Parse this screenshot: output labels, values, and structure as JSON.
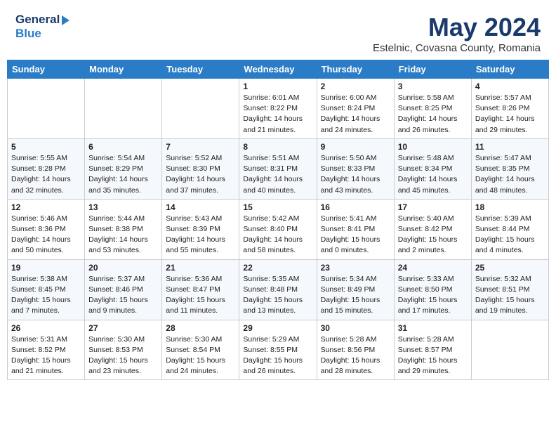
{
  "header": {
    "logo_line1": "General",
    "logo_line2": "Blue",
    "month": "May 2024",
    "location": "Estelnic, Covasna County, Romania"
  },
  "weekdays": [
    "Sunday",
    "Monday",
    "Tuesday",
    "Wednesday",
    "Thursday",
    "Friday",
    "Saturday"
  ],
  "weeks": [
    [
      {
        "day": "",
        "info": ""
      },
      {
        "day": "",
        "info": ""
      },
      {
        "day": "",
        "info": ""
      },
      {
        "day": "1",
        "info": "Sunrise: 6:01 AM\nSunset: 8:22 PM\nDaylight: 14 hours\nand 21 minutes."
      },
      {
        "day": "2",
        "info": "Sunrise: 6:00 AM\nSunset: 8:24 PM\nDaylight: 14 hours\nand 24 minutes."
      },
      {
        "day": "3",
        "info": "Sunrise: 5:58 AM\nSunset: 8:25 PM\nDaylight: 14 hours\nand 26 minutes."
      },
      {
        "day": "4",
        "info": "Sunrise: 5:57 AM\nSunset: 8:26 PM\nDaylight: 14 hours\nand 29 minutes."
      }
    ],
    [
      {
        "day": "5",
        "info": "Sunrise: 5:55 AM\nSunset: 8:28 PM\nDaylight: 14 hours\nand 32 minutes."
      },
      {
        "day": "6",
        "info": "Sunrise: 5:54 AM\nSunset: 8:29 PM\nDaylight: 14 hours\nand 35 minutes."
      },
      {
        "day": "7",
        "info": "Sunrise: 5:52 AM\nSunset: 8:30 PM\nDaylight: 14 hours\nand 37 minutes."
      },
      {
        "day": "8",
        "info": "Sunrise: 5:51 AM\nSunset: 8:31 PM\nDaylight: 14 hours\nand 40 minutes."
      },
      {
        "day": "9",
        "info": "Sunrise: 5:50 AM\nSunset: 8:33 PM\nDaylight: 14 hours\nand 43 minutes."
      },
      {
        "day": "10",
        "info": "Sunrise: 5:48 AM\nSunset: 8:34 PM\nDaylight: 14 hours\nand 45 minutes."
      },
      {
        "day": "11",
        "info": "Sunrise: 5:47 AM\nSunset: 8:35 PM\nDaylight: 14 hours\nand 48 minutes."
      }
    ],
    [
      {
        "day": "12",
        "info": "Sunrise: 5:46 AM\nSunset: 8:36 PM\nDaylight: 14 hours\nand 50 minutes."
      },
      {
        "day": "13",
        "info": "Sunrise: 5:44 AM\nSunset: 8:38 PM\nDaylight: 14 hours\nand 53 minutes."
      },
      {
        "day": "14",
        "info": "Sunrise: 5:43 AM\nSunset: 8:39 PM\nDaylight: 14 hours\nand 55 minutes."
      },
      {
        "day": "15",
        "info": "Sunrise: 5:42 AM\nSunset: 8:40 PM\nDaylight: 14 hours\nand 58 minutes."
      },
      {
        "day": "16",
        "info": "Sunrise: 5:41 AM\nSunset: 8:41 PM\nDaylight: 15 hours\nand 0 minutes."
      },
      {
        "day": "17",
        "info": "Sunrise: 5:40 AM\nSunset: 8:42 PM\nDaylight: 15 hours\nand 2 minutes."
      },
      {
        "day": "18",
        "info": "Sunrise: 5:39 AM\nSunset: 8:44 PM\nDaylight: 15 hours\nand 4 minutes."
      }
    ],
    [
      {
        "day": "19",
        "info": "Sunrise: 5:38 AM\nSunset: 8:45 PM\nDaylight: 15 hours\nand 7 minutes."
      },
      {
        "day": "20",
        "info": "Sunrise: 5:37 AM\nSunset: 8:46 PM\nDaylight: 15 hours\nand 9 minutes."
      },
      {
        "day": "21",
        "info": "Sunrise: 5:36 AM\nSunset: 8:47 PM\nDaylight: 15 hours\nand 11 minutes."
      },
      {
        "day": "22",
        "info": "Sunrise: 5:35 AM\nSunset: 8:48 PM\nDaylight: 15 hours\nand 13 minutes."
      },
      {
        "day": "23",
        "info": "Sunrise: 5:34 AM\nSunset: 8:49 PM\nDaylight: 15 hours\nand 15 minutes."
      },
      {
        "day": "24",
        "info": "Sunrise: 5:33 AM\nSunset: 8:50 PM\nDaylight: 15 hours\nand 17 minutes."
      },
      {
        "day": "25",
        "info": "Sunrise: 5:32 AM\nSunset: 8:51 PM\nDaylight: 15 hours\nand 19 minutes."
      }
    ],
    [
      {
        "day": "26",
        "info": "Sunrise: 5:31 AM\nSunset: 8:52 PM\nDaylight: 15 hours\nand 21 minutes."
      },
      {
        "day": "27",
        "info": "Sunrise: 5:30 AM\nSunset: 8:53 PM\nDaylight: 15 hours\nand 23 minutes."
      },
      {
        "day": "28",
        "info": "Sunrise: 5:30 AM\nSunset: 8:54 PM\nDaylight: 15 hours\nand 24 minutes."
      },
      {
        "day": "29",
        "info": "Sunrise: 5:29 AM\nSunset: 8:55 PM\nDaylight: 15 hours\nand 26 minutes."
      },
      {
        "day": "30",
        "info": "Sunrise: 5:28 AM\nSunset: 8:56 PM\nDaylight: 15 hours\nand 28 minutes."
      },
      {
        "day": "31",
        "info": "Sunrise: 5:28 AM\nSunset: 8:57 PM\nDaylight: 15 hours\nand 29 minutes."
      },
      {
        "day": "",
        "info": ""
      }
    ]
  ]
}
